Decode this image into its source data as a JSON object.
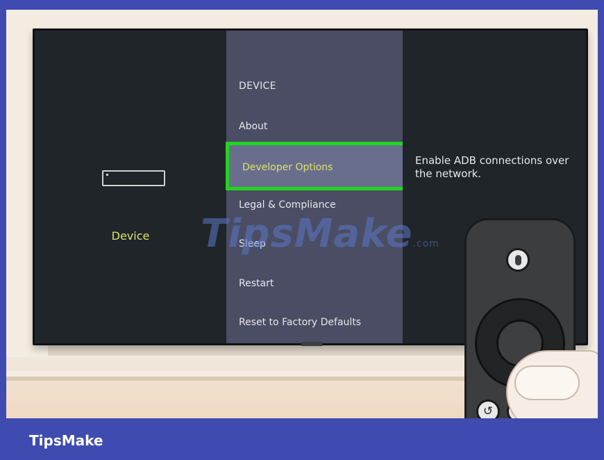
{
  "tv": {
    "left_pane": {
      "device_label": "Device"
    },
    "menu": {
      "header": "DEVICE",
      "items": [
        {
          "label": "About"
        },
        {
          "label": "Developer Options",
          "selected": true
        },
        {
          "label": "Legal & Compliance"
        },
        {
          "label": "Sleep"
        },
        {
          "label": "Restart"
        },
        {
          "label": "Reset to Factory Defaults"
        }
      ]
    },
    "description": "Enable ADB connections over the network."
  },
  "watermark": {
    "text": "TipsMake",
    "suffix": ".com"
  },
  "remote": {
    "buttons": [
      "mic-icon",
      "navigation-ring",
      "select-button",
      "back-icon",
      "home-icon"
    ]
  },
  "banner": {
    "brand": "TipsMake"
  },
  "colors": {
    "highlight_border": "#21d41f",
    "selected_text": "#d7e46a",
    "menu_background": "#4a4d63",
    "screen_background": "#1f2528",
    "banner_background": "#3f4bb0"
  }
}
